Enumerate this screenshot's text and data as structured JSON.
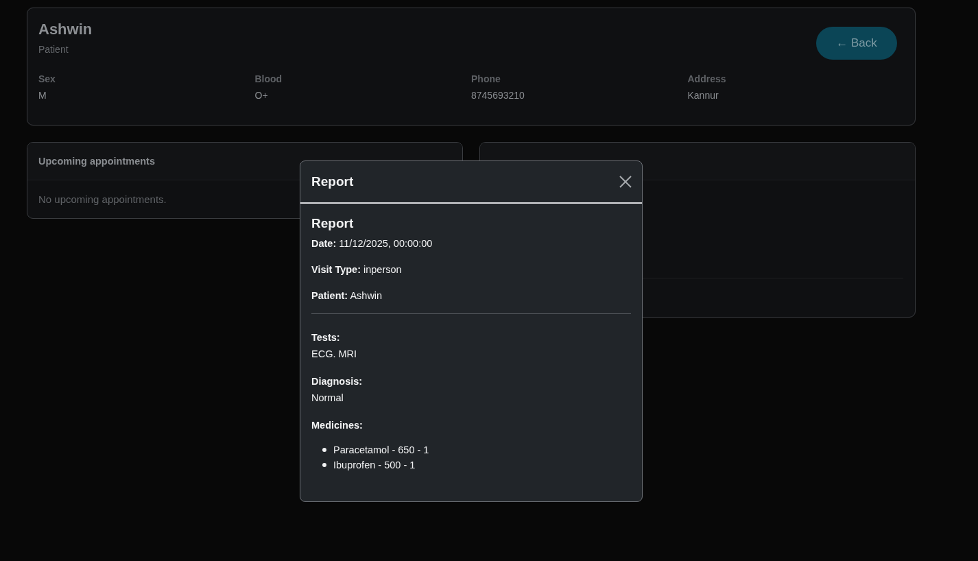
{
  "profile": {
    "name": "Ashwin",
    "role": "Patient",
    "back_button": "← Back",
    "fields": [
      {
        "label": "Sex",
        "value": "M"
      },
      {
        "label": "Blood",
        "value": "O+"
      },
      {
        "label": "Phone",
        "value": "8745693210"
      },
      {
        "label": "Address",
        "value": "Kannur"
      }
    ]
  },
  "upcoming": {
    "title": "Upcoming appointments",
    "empty_text": "No upcoming appointments."
  },
  "modal": {
    "title": "Report",
    "heading": "Report",
    "details": [
      "**Date:** 11/12/2025, 00:00:00",
      "**Visit Type:** inperson",
      "**Patient:** Ashwin"
    ],
    "sections": [
      {
        "label": "Tests:",
        "value": "ECG. MRI"
      },
      {
        "label": "Diagnosis:",
        "value": "Normal"
      }
    ],
    "medicines_label": "Medicines:",
    "medicines": [
      "Paracetamol - 650 - 1",
      "Ibuprofen - 500 - 1"
    ]
  }
}
